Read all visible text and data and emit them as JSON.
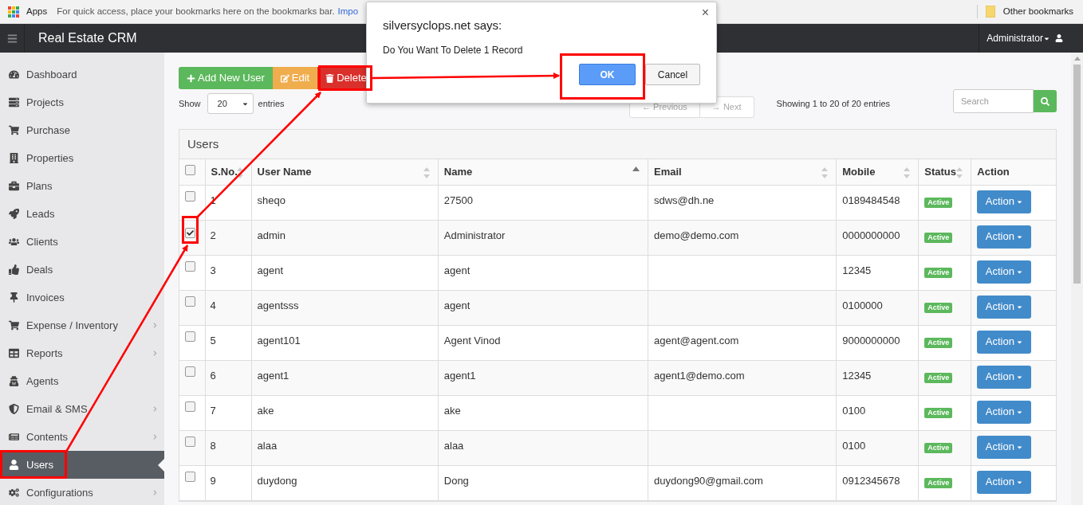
{
  "bookmarks_bar": {
    "apps": "Apps",
    "hint": "For quick access, place your bookmarks here on the bookmarks bar.",
    "link": "Impo",
    "other": "Other bookmarks"
  },
  "header": {
    "title": "Real Estate CRM",
    "user": "Administrator"
  },
  "sidebar": {
    "items": [
      {
        "label": "Dashboard",
        "has_submenu": false,
        "selected": false
      },
      {
        "label": "Projects",
        "has_submenu": false,
        "selected": false
      },
      {
        "label": "Purchase",
        "has_submenu": false,
        "selected": false
      },
      {
        "label": "Properties",
        "has_submenu": false,
        "selected": false
      },
      {
        "label": "Plans",
        "has_submenu": false,
        "selected": false
      },
      {
        "label": "Leads",
        "has_submenu": false,
        "selected": false
      },
      {
        "label": "Clients",
        "has_submenu": false,
        "selected": false
      },
      {
        "label": "Deals",
        "has_submenu": false,
        "selected": false
      },
      {
        "label": "Invoices",
        "has_submenu": false,
        "selected": false
      },
      {
        "label": "Expense / Inventory",
        "has_submenu": true,
        "selected": false
      },
      {
        "label": "Reports",
        "has_submenu": true,
        "selected": false
      },
      {
        "label": "Agents",
        "has_submenu": false,
        "selected": false
      },
      {
        "label": "Email & SMS",
        "has_submenu": true,
        "selected": false
      },
      {
        "label": "Contents",
        "has_submenu": true,
        "selected": false
      },
      {
        "label": "Users",
        "has_submenu": false,
        "selected": true
      },
      {
        "label": "Configurations",
        "has_submenu": true,
        "selected": false
      }
    ]
  },
  "toolbar": [
    {
      "kind": "add",
      "label": "Add New User"
    },
    {
      "kind": "edit",
      "label": "Edit"
    },
    {
      "kind": "delete",
      "label": "Delete"
    }
  ],
  "length": {
    "before": "Show",
    "value": "20",
    "after": "entries"
  },
  "pagination": [
    {
      "label": "← Previous",
      "disabled": true
    },
    {
      "label": "→ Next",
      "disabled": true
    }
  ],
  "info": "Showing 1 to 20 of 20 entries",
  "search": {
    "placeholder": "Search"
  },
  "panel": {
    "title": "Users",
    "columns": [
      {
        "kind": "check",
        "checked": false
      },
      {
        "label": "S.No.",
        "sortable": true,
        "sorted": false
      },
      {
        "label": "User Name",
        "sortable": true,
        "sorted": false
      },
      {
        "label": "Name",
        "sortable": true,
        "sorted": true
      },
      {
        "label": "Email",
        "sortable": true,
        "sorted": false
      },
      {
        "label": "Mobile",
        "sortable": true,
        "sorted": false
      },
      {
        "label": "Status",
        "sortable": true,
        "sorted": false
      },
      {
        "label": "Action",
        "sortable": false
      }
    ],
    "rows": [
      {
        "checked": false,
        "sno": "1",
        "username": "sheqo",
        "name": "27500",
        "email": "sdws@dh.ne",
        "mobile": "0189484548",
        "status": "Active",
        "action": "Action"
      },
      {
        "checked": true,
        "sno": "2",
        "username": "admin",
        "name": "Administrator",
        "email": "demo@demo.com",
        "mobile": "0000000000",
        "status": "Active",
        "action": "Action"
      },
      {
        "checked": false,
        "sno": "3",
        "username": "agent",
        "name": "agent",
        "mobile": "12345",
        "status": "Active",
        "action": "Action"
      },
      {
        "checked": false,
        "sno": "4",
        "username": "agentsss",
        "name": "agent",
        "mobile": "0100000",
        "status": "Active",
        "action": "Action"
      },
      {
        "checked": false,
        "sno": "5",
        "username": "agent101",
        "name": "Agent Vinod",
        "email": "agent@agent.com",
        "mobile": "9000000000",
        "status": "Active",
        "action": "Action"
      },
      {
        "checked": false,
        "sno": "6",
        "username": "agent1",
        "name": "agent1",
        "email": "agent1@demo.com",
        "mobile": "12345",
        "status": "Active",
        "action": "Action"
      },
      {
        "checked": false,
        "sno": "7",
        "username": "ake",
        "name": "ake",
        "mobile": "0100",
        "status": "Active",
        "action": "Action"
      },
      {
        "checked": false,
        "sno": "8",
        "username": "alaa",
        "name": "alaa",
        "mobile": "0100",
        "status": "Active",
        "action": "Action"
      },
      {
        "checked": false,
        "sno": "9",
        "username": "duydong",
        "name": "Dong",
        "email": "duydong90@gmail.com",
        "mobile": "0912345678",
        "status": "Active",
        "action": "Action"
      }
    ]
  },
  "dialog": {
    "title": "silversyclops.net says:",
    "message": "Do You Want To Delete 1 Record",
    "ok": "OK",
    "cancel": "Cancel",
    "close": "×"
  }
}
